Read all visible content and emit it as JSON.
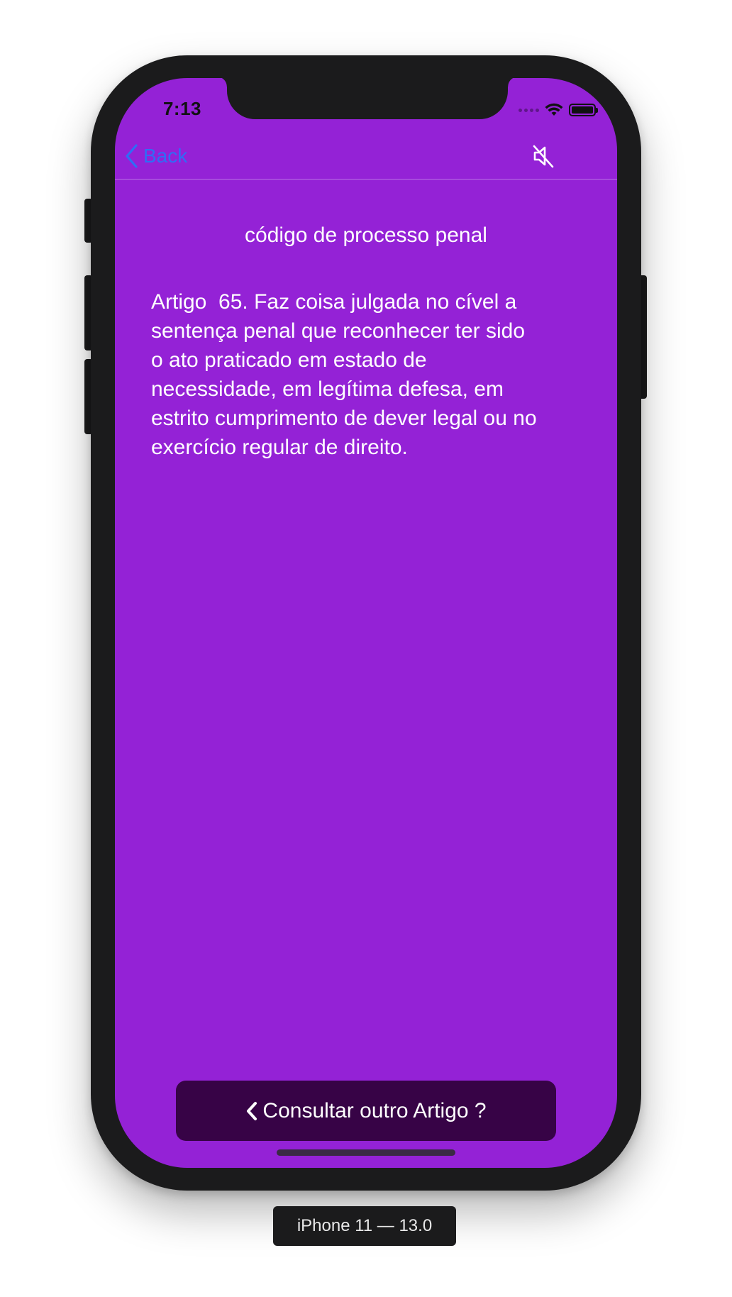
{
  "status_bar": {
    "time": "7:13"
  },
  "nav": {
    "back_label": "Back",
    "back_color": "#2f6df6"
  },
  "content": {
    "title": "código de processo penal",
    "article": "Artigo  65. Faz coisa julgada no cível a\nsentença penal que reconhecer ter sido\no ato praticado em estado de\nnecessidade, em legítima defesa, em\nestrito cumprimento de dever legal ou no\nexercício regular de direito."
  },
  "footer": {
    "consult_label": "Consultar outro Artigo ?"
  },
  "device": {
    "label": "iPhone 11 — 13.0"
  },
  "theme": {
    "background": "#9422d6",
    "button_bg": "#370346",
    "text": "#ffffff"
  },
  "icons": {
    "back": "chevron-left-icon",
    "mute": "speaker-muted-icon",
    "consult": "chevron-left-icon",
    "wifi": "wifi-icon",
    "battery": "battery-icon",
    "signal": "cellular-signal-icon"
  }
}
